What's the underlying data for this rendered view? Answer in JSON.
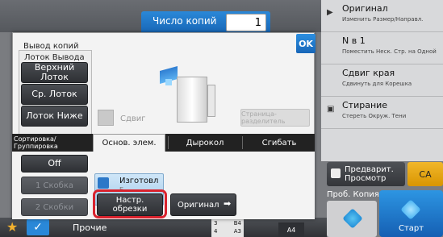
{
  "header": {
    "copies_label": "Число копий",
    "copies_value": "1"
  },
  "right_panel": {
    "items": [
      {
        "title": "Оригинал",
        "sub": "Изменить Размер/Направл.",
        "icon": "arrow-right-icon"
      },
      {
        "title": "N в 1",
        "sub": "Поместить Неск. Стр. на Одной",
        "icon": "none"
      },
      {
        "title": "Сдвиг края",
        "sub": "Сдвинуть для Корешка",
        "icon": "none"
      },
      {
        "title": "Стирание",
        "sub": "Стереть Окруж. Тени",
        "icon": "copy-icon"
      }
    ],
    "preview_label": "Предварит. Просмотр",
    "ca_label": "CA",
    "proof_label": "Проб. Копия",
    "start_label": "Старт"
  },
  "dialog": {
    "ok_label": "OK",
    "output_title": "Вывод копий",
    "tray_group_label": "Лоток Вывода",
    "tray_buttons": [
      "Верхний Лоток",
      "Ср. Лоток",
      "Лоток Ниже"
    ],
    "shift_label": "Сдвиг",
    "separator_label": "Страница-разделитель",
    "tabs": [
      "Сортировка/Группировка",
      "Основ. элем.",
      "Дырокол",
      "Сгибать"
    ],
    "off_label": "Off",
    "staple_1": "1 Скобка",
    "staple_2": "2 Скобки",
    "maker_label": "Изготовл",
    "maker_sub": "Б...",
    "trim_label": "Настр. обрезки",
    "original_label": "Оригинал"
  },
  "bottom_bar": {
    "other_label": "Прочие",
    "tray_rows": [
      [
        "3",
        "B4"
      ],
      [
        "4",
        "A3"
      ]
    ],
    "paper_size": "A4"
  },
  "colors": {
    "accent_blue": "#1f78cc",
    "highlight_red": "#d9232e",
    "ca_yellow": "#e9a81a"
  }
}
